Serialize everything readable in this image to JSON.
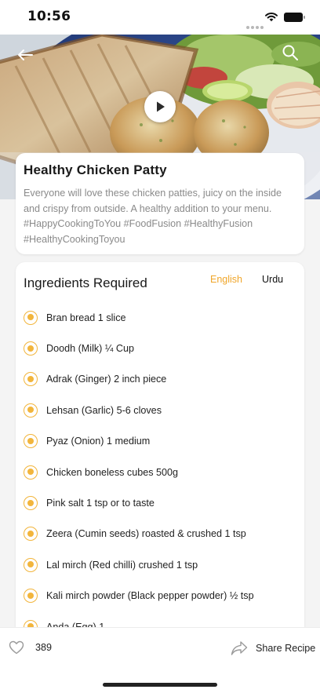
{
  "status_bar": {
    "time": "10:56"
  },
  "recipe": {
    "title": "Healthy Chicken Patty",
    "description": "Everyone will love these chicken patties, juicy on the inside and crispy from outside. A healthy addition to your menu. #HappyCookingToYou #FoodFusion #HealthyFusion #HealthyCookingToyou"
  },
  "ingredients": {
    "heading": "Ingredients Required",
    "tabs": {
      "english": "English",
      "urdu": "Urdu",
      "selected": "English"
    },
    "items": [
      "Bran bread 1 slice",
      "Doodh (Milk) ¼ Cup",
      "Adrak (Ginger) 2 inch piece",
      "Lehsan (Garlic) 5-6 cloves",
      "Pyaz (Onion) 1 medium",
      "Chicken boneless cubes 500g",
      "Pink salt 1 tsp or to taste",
      "Zeera (Cumin seeds) roasted & crushed 1 tsp",
      "Lal mirch (Red chilli) crushed 1 tsp",
      "Kali mirch powder (Black pepper powder) ½ tsp",
      "Anda (Egg) 1"
    ]
  },
  "bottom_bar": {
    "like_count": "389",
    "share_label": "Share Recipe"
  },
  "colors": {
    "accent": "#f0a62a",
    "bullet": "#f2b53c"
  },
  "icons": [
    "back-arrow-icon",
    "search-icon",
    "play-icon",
    "heart-icon",
    "share-icon",
    "wifi-icon",
    "battery-icon"
  ]
}
